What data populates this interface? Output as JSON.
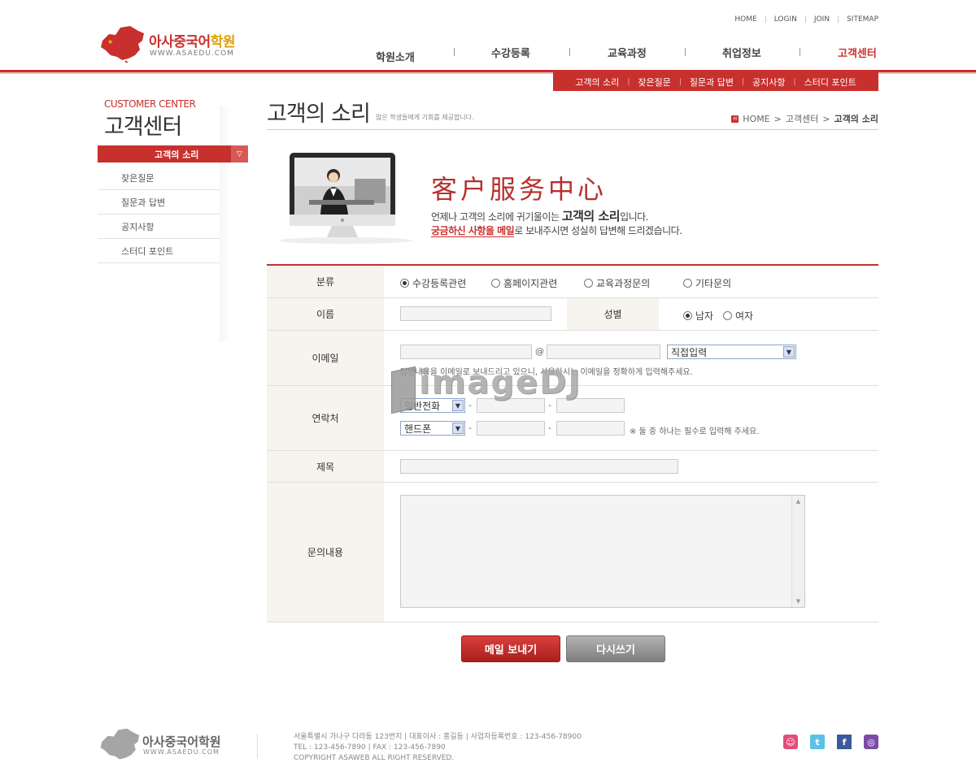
{
  "brand": {
    "name_main": "아사중국어",
    "name_highlight": "학원",
    "url": "WWW.ASAEDU.COM"
  },
  "util_nav": [
    "HOME",
    "LOGIN",
    "JOIN",
    "SITEMAP"
  ],
  "gnb": [
    "학원소개",
    "수강등록",
    "교육과정",
    "취업정보",
    "고객센터"
  ],
  "lnb": [
    "고객의 소리",
    "잦은질문",
    "질문과 답변",
    "공지사항",
    "스터디 포인트"
  ],
  "sidebar": {
    "title_en": "CUSTOMER CENTER",
    "title_ko": "고객센터",
    "active": "고객의 소리",
    "items": [
      "잦은질문",
      "질문과 답변",
      "공지사항",
      "스터디 포인트"
    ]
  },
  "content": {
    "title": "고객의 소리",
    "desc": "많은 학생들에게 기회를 제공합니다.",
    "breadcrumb": [
      "HOME",
      "고객센터",
      "고객의 소리"
    ]
  },
  "banner": {
    "cn_title": "客户服务中心",
    "line1_pre": "언제나 고객의 소리에 귀기울이는 ",
    "line1_big": "고객의 소리",
    "line1_post": "입니다.",
    "line2_red": "궁금하신 사항을 메일",
    "line2_post": "로 보내주시면 성실히 답변해 드리겠습니다."
  },
  "form": {
    "category_label": "분류",
    "category_options": [
      "수강등록관련",
      "홈페이지관련",
      "교육과정문의",
      "기타문의"
    ],
    "category_selected": 0,
    "name_label": "이름",
    "gender_label": "성별",
    "gender_options": [
      "남자",
      "여자"
    ],
    "email_label": "이메일",
    "email_at": "@",
    "email_domain_select": "직접입력",
    "email_note": "답변내용을 이메일로 보내드리고 있으니, 사용하시는 이메일을 정확하게 입력해주세요.",
    "contact_label": "연락처",
    "phone_select": "일반전화",
    "mobile_select": "핸드폰",
    "dash": "-",
    "contact_note": "※ 둘 중 하나는 필수로 입력해 주세요.",
    "subject_label": "제목",
    "content_label": "문의내용"
  },
  "buttons": {
    "send": "메일 보내기",
    "reset": "다시쓰기"
  },
  "watermark": "imageDJ",
  "footer": {
    "brand": "아사중국어학원",
    "url": "WWW.ASAEDU.COM",
    "line1": "서울특별시 가나구 다라동 123번지  |  대표이사 : 홍길동  |  사업자등록번호 : 123-456-78900",
    "line2": "TEL : 123-456-7890  |  FAX : 123-456-7890",
    "line3": "COPYRIGHT ASAWEB ALL RIGHT RESERVED."
  },
  "colors": {
    "accent": "#c8302e",
    "label_bg": "#f7f3ee"
  },
  "sns_icons": [
    "me2day-icon",
    "twitter-icon",
    "facebook-icon",
    "yozm-icon"
  ]
}
